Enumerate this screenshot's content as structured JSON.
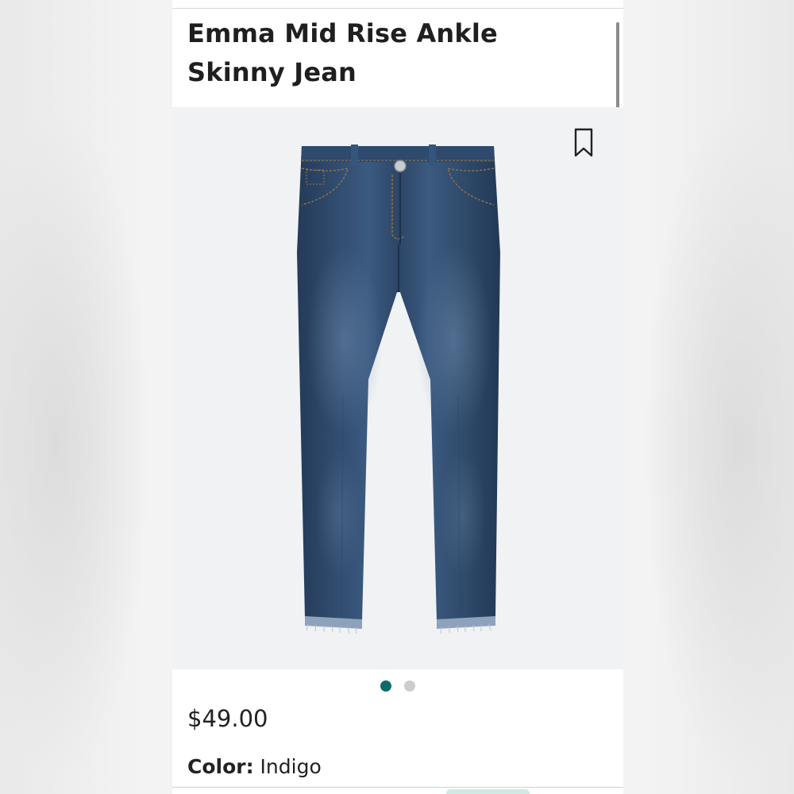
{
  "product": {
    "title": "Emma Mid Rise Ankle Skinny Jean",
    "price": "$49.00",
    "color_label": "Color:",
    "color_value": "Indigo"
  },
  "gallery": {
    "image_count": 2,
    "active_index": 0,
    "save_icon": "bookmark-icon",
    "product_image": "dark-wash-skinny-jeans-image"
  },
  "colors": {
    "dot_active": "#0f6b6b",
    "dot_inactive": "#cccccc",
    "denim": "#2b4566"
  }
}
